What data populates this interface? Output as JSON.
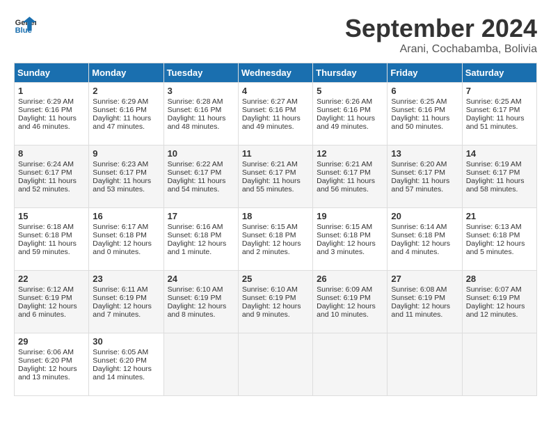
{
  "logo": {
    "line1": "General",
    "line2": "Blue"
  },
  "title": "September 2024",
  "location": "Arani, Cochabamba, Bolivia",
  "days_of_week": [
    "Sunday",
    "Monday",
    "Tuesday",
    "Wednesday",
    "Thursday",
    "Friday",
    "Saturday"
  ],
  "weeks": [
    [
      {
        "day": 1,
        "sunrise": "6:29 AM",
        "sunset": "6:16 PM",
        "daylight": "11 hours and 46 minutes."
      },
      {
        "day": 2,
        "sunrise": "6:29 AM",
        "sunset": "6:16 PM",
        "daylight": "11 hours and 47 minutes."
      },
      {
        "day": 3,
        "sunrise": "6:28 AM",
        "sunset": "6:16 PM",
        "daylight": "11 hours and 48 minutes."
      },
      {
        "day": 4,
        "sunrise": "6:27 AM",
        "sunset": "6:16 PM",
        "daylight": "11 hours and 49 minutes."
      },
      {
        "day": 5,
        "sunrise": "6:26 AM",
        "sunset": "6:16 PM",
        "daylight": "11 hours and 49 minutes."
      },
      {
        "day": 6,
        "sunrise": "6:25 AM",
        "sunset": "6:16 PM",
        "daylight": "11 hours and 50 minutes."
      },
      {
        "day": 7,
        "sunrise": "6:25 AM",
        "sunset": "6:17 PM",
        "daylight": "11 hours and 51 minutes."
      }
    ],
    [
      {
        "day": 8,
        "sunrise": "6:24 AM",
        "sunset": "6:17 PM",
        "daylight": "11 hours and 52 minutes."
      },
      {
        "day": 9,
        "sunrise": "6:23 AM",
        "sunset": "6:17 PM",
        "daylight": "11 hours and 53 minutes."
      },
      {
        "day": 10,
        "sunrise": "6:22 AM",
        "sunset": "6:17 PM",
        "daylight": "11 hours and 54 minutes."
      },
      {
        "day": 11,
        "sunrise": "6:21 AM",
        "sunset": "6:17 PM",
        "daylight": "11 hours and 55 minutes."
      },
      {
        "day": 12,
        "sunrise": "6:21 AM",
        "sunset": "6:17 PM",
        "daylight": "11 hours and 56 minutes."
      },
      {
        "day": 13,
        "sunrise": "6:20 AM",
        "sunset": "6:17 PM",
        "daylight": "11 hours and 57 minutes."
      },
      {
        "day": 14,
        "sunrise": "6:19 AM",
        "sunset": "6:17 PM",
        "daylight": "11 hours and 58 minutes."
      }
    ],
    [
      {
        "day": 15,
        "sunrise": "6:18 AM",
        "sunset": "6:18 PM",
        "daylight": "11 hours and 59 minutes."
      },
      {
        "day": 16,
        "sunrise": "6:17 AM",
        "sunset": "6:18 PM",
        "daylight": "12 hours and 0 minutes."
      },
      {
        "day": 17,
        "sunrise": "6:16 AM",
        "sunset": "6:18 PM",
        "daylight": "12 hours and 1 minute."
      },
      {
        "day": 18,
        "sunrise": "6:15 AM",
        "sunset": "6:18 PM",
        "daylight": "12 hours and 2 minutes."
      },
      {
        "day": 19,
        "sunrise": "6:15 AM",
        "sunset": "6:18 PM",
        "daylight": "12 hours and 3 minutes."
      },
      {
        "day": 20,
        "sunrise": "6:14 AM",
        "sunset": "6:18 PM",
        "daylight": "12 hours and 4 minutes."
      },
      {
        "day": 21,
        "sunrise": "6:13 AM",
        "sunset": "6:18 PM",
        "daylight": "12 hours and 5 minutes."
      }
    ],
    [
      {
        "day": 22,
        "sunrise": "6:12 AM",
        "sunset": "6:19 PM",
        "daylight": "12 hours and 6 minutes."
      },
      {
        "day": 23,
        "sunrise": "6:11 AM",
        "sunset": "6:19 PM",
        "daylight": "12 hours and 7 minutes."
      },
      {
        "day": 24,
        "sunrise": "6:10 AM",
        "sunset": "6:19 PM",
        "daylight": "12 hours and 8 minutes."
      },
      {
        "day": 25,
        "sunrise": "6:10 AM",
        "sunset": "6:19 PM",
        "daylight": "12 hours and 9 minutes."
      },
      {
        "day": 26,
        "sunrise": "6:09 AM",
        "sunset": "6:19 PM",
        "daylight": "12 hours and 10 minutes."
      },
      {
        "day": 27,
        "sunrise": "6:08 AM",
        "sunset": "6:19 PM",
        "daylight": "12 hours and 11 minutes."
      },
      {
        "day": 28,
        "sunrise": "6:07 AM",
        "sunset": "6:19 PM",
        "daylight": "12 hours and 12 minutes."
      }
    ],
    [
      {
        "day": 29,
        "sunrise": "6:06 AM",
        "sunset": "6:20 PM",
        "daylight": "12 hours and 13 minutes."
      },
      {
        "day": 30,
        "sunrise": "6:05 AM",
        "sunset": "6:20 PM",
        "daylight": "12 hours and 14 minutes."
      },
      null,
      null,
      null,
      null,
      null
    ]
  ]
}
